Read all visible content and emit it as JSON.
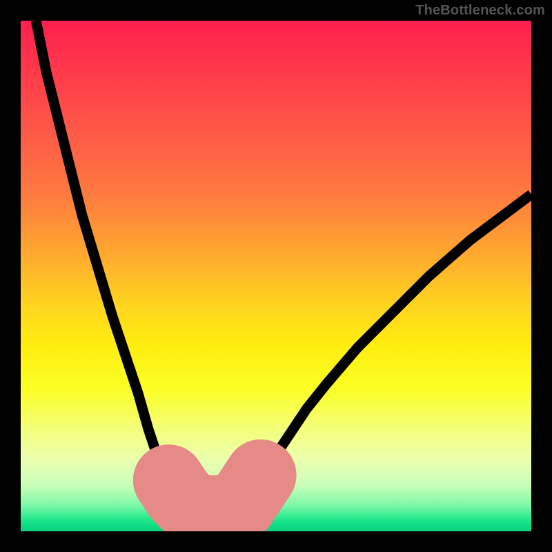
{
  "watermark": "TheBottleneck.com",
  "chart_data": {
    "type": "line",
    "title": "",
    "xlabel": "",
    "ylabel": "",
    "xlim": [
      0,
      100
    ],
    "ylim": [
      0,
      100
    ],
    "grid": false,
    "legend": false,
    "series": [
      {
        "name": "left-curve",
        "x": [
          3,
          5,
          8,
          10,
          12,
          15,
          18,
          20,
          23,
          25,
          27,
          28,
          30,
          32,
          34
        ],
        "values": [
          100,
          90,
          78,
          70,
          62,
          52,
          42,
          36,
          27,
          20,
          14,
          11,
          7,
          5,
          4
        ]
      },
      {
        "name": "right-curve",
        "x": [
          44,
          46,
          48,
          52,
          56,
          60,
          66,
          72,
          80,
          88,
          96,
          100
        ],
        "values": [
          6,
          9,
          12,
          18,
          24,
          29,
          36,
          42,
          50,
          57,
          63,
          66
        ]
      },
      {
        "name": "bottom-flat",
        "x": [
          34,
          36,
          38,
          40,
          42,
          44
        ],
        "values": [
          4,
          4,
          4,
          4,
          4,
          5
        ]
      }
    ],
    "marker_region": {
      "name": "sweet-spot-highlight",
      "x": [
        29,
        31,
        33,
        36,
        40,
        43,
        45,
        47
      ],
      "values": [
        10,
        7,
        5,
        4,
        4,
        5,
        8,
        11
      ]
    },
    "gradient_stops_pct": [
      0,
      10,
      22,
      34,
      46,
      56,
      64,
      72,
      80,
      86,
      91,
      95,
      98,
      100
    ],
    "gradient_colors": [
      "#ff1f4f",
      "#ff3a4a",
      "#ff5a47",
      "#ff7a3f",
      "#ffaa2e",
      "#ffd61e",
      "#ffee10",
      "#fbff24",
      "#f4ff7a",
      "#ecffb0",
      "#c8ffb8",
      "#7cf8a7",
      "#18e68a",
      "#08d080"
    ]
  }
}
